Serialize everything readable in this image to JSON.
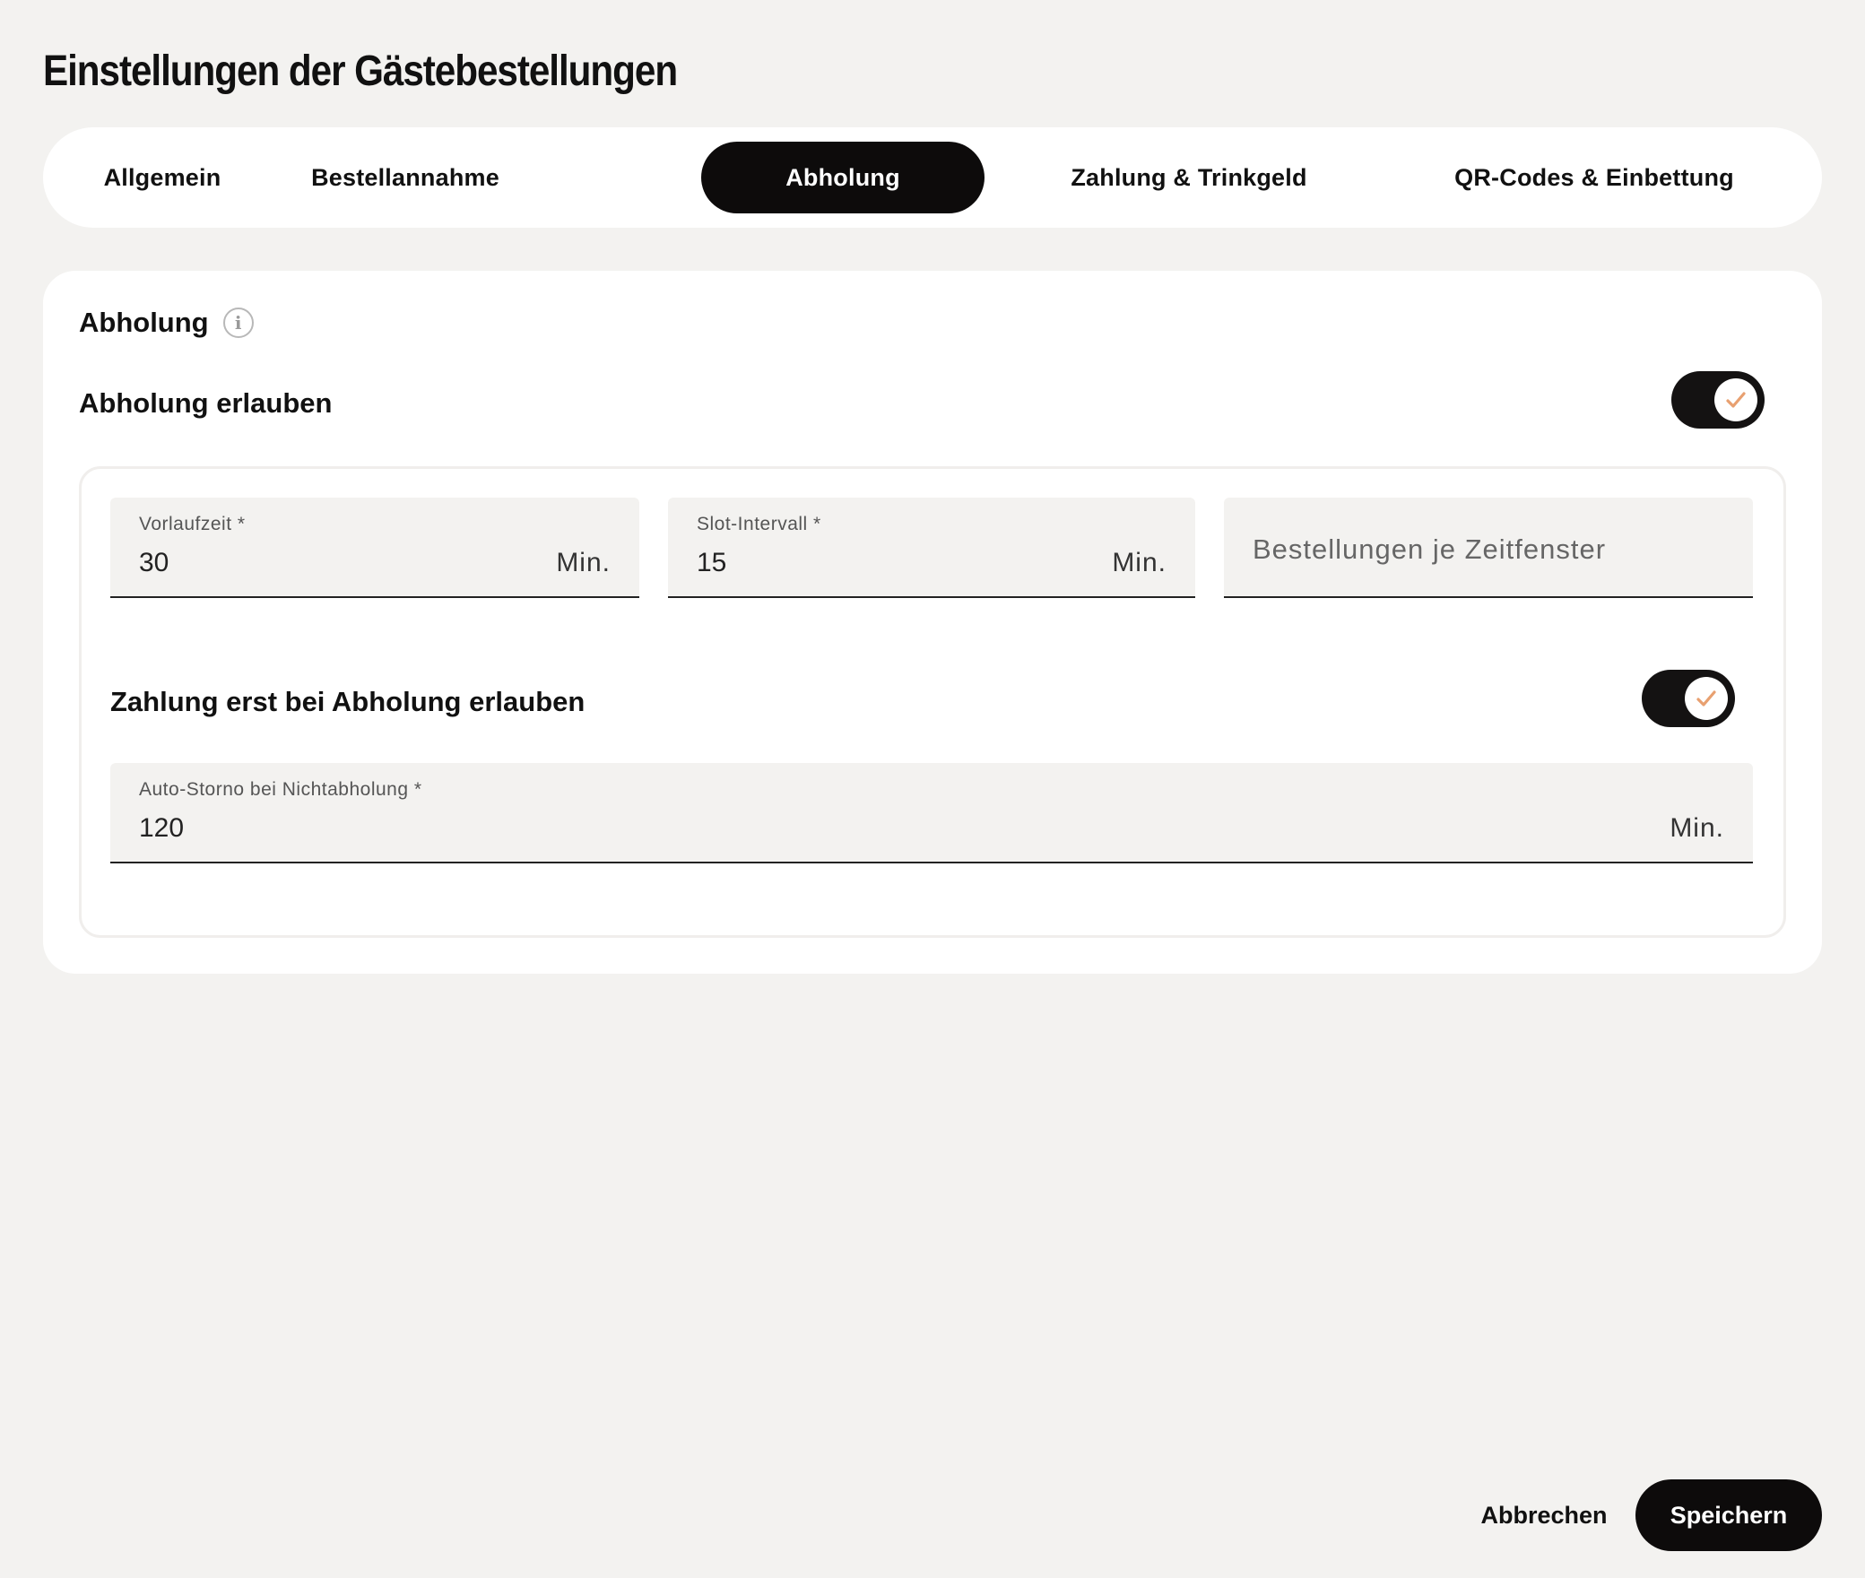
{
  "dialog": {
    "title": "Einstellungen der Gästebestellungen"
  },
  "tabs": [
    {
      "label": "Allgemein",
      "active": false
    },
    {
      "label": "Bestellannahme",
      "active": false
    },
    {
      "label": "Abholung",
      "active": true
    },
    {
      "label": "Zahlung & Trinkgeld",
      "active": false
    },
    {
      "label": "QR-Codes & Einbettung",
      "active": false
    }
  ],
  "section": {
    "title": "Abholung",
    "info_icon": "info-icon"
  },
  "allow_pickup": {
    "label": "Abholung erlauben",
    "enabled": true,
    "icon": "check-icon"
  },
  "fields": {
    "lead_time": {
      "label": "Vorlaufzeit *",
      "value": "30",
      "suffix": "Min."
    },
    "slot_interval": {
      "label": "Slot-Intervall *",
      "value": "15",
      "suffix": "Min."
    },
    "orders_per_slot": {
      "placeholder": "Bestellungen je Zeitfenster",
      "value": ""
    },
    "auto_cancel": {
      "label": "Auto-Storno bei Nichtabholung *",
      "value": "120",
      "suffix": "Min."
    }
  },
  "pay_on_pickup": {
    "label": "Zahlung erst bei Abholung erlauben",
    "enabled": true,
    "icon": "check-icon"
  },
  "footer": {
    "cancel_label": "Abbrechen",
    "save_label": "Speichern"
  },
  "colors": {
    "background": "#f3f2f0",
    "surface": "#ffffff",
    "primary": "#0d0b0b",
    "check_accent": "#e8a070"
  }
}
